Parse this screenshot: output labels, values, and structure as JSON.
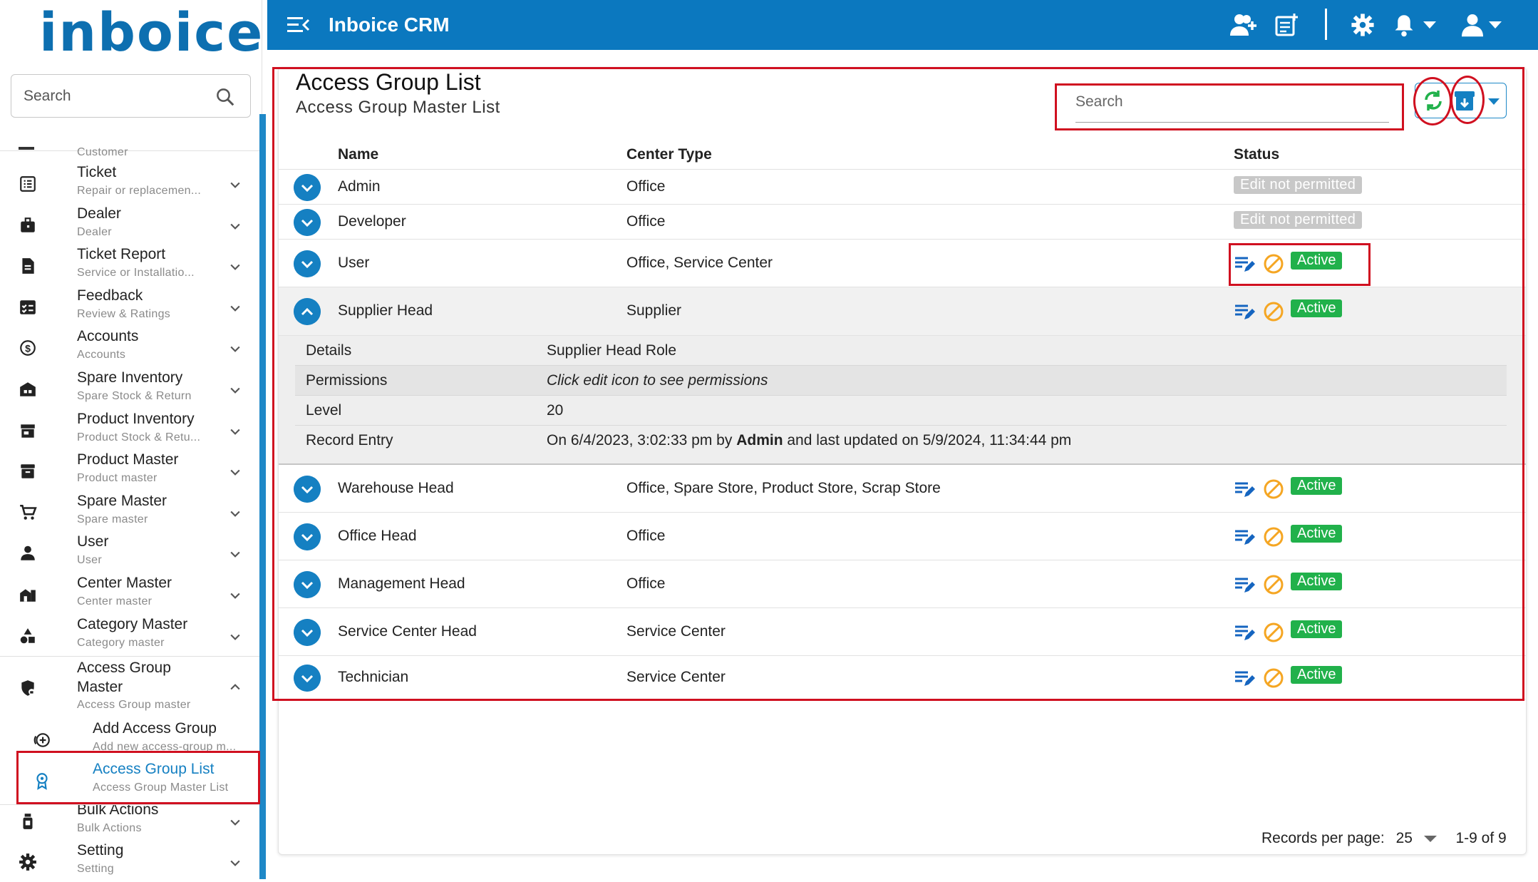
{
  "sidebar": {
    "logo_text": "inboice",
    "search_placeholder": "Search",
    "partial_item_sub": "Customer",
    "items": [
      {
        "label": "Ticket",
        "sub": "Repair or replacemen...",
        "icon": "list-icon"
      },
      {
        "label": "Dealer",
        "sub": "Dealer",
        "icon": "briefcase-icon"
      },
      {
        "label": "Ticket Report",
        "sub": "Service or Installatio...",
        "icon": "report-icon"
      },
      {
        "label": "Feedback",
        "sub": "Review & Ratings",
        "icon": "checklist-icon"
      },
      {
        "label": "Accounts",
        "sub": "Accounts",
        "icon": "currency-exchange-icon"
      },
      {
        "label": "Spare Inventory",
        "sub": "Spare Stock & Return",
        "icon": "warehouse-icon"
      },
      {
        "label": "Product Inventory",
        "sub": "Product Stock & Retu...",
        "icon": "store-icon"
      },
      {
        "label": "Product Master",
        "sub": "Product master",
        "icon": "archive-icon"
      },
      {
        "label": "Spare Master",
        "sub": "Spare master",
        "icon": "cart-icon"
      },
      {
        "label": "User",
        "sub": "User",
        "icon": "person-icon"
      },
      {
        "label": "Center Master",
        "sub": "Center master",
        "icon": "building-icon"
      },
      {
        "label": "Category Master",
        "sub": "Category master",
        "icon": "shapes-icon"
      }
    ],
    "access_group": {
      "label_line1": "Access Group",
      "label_line2": "Master",
      "sub": "Access Group master"
    },
    "sub_items": [
      {
        "label": "Add Access Group",
        "sub": "Add new access-group m..."
      },
      {
        "label": "Access Group List",
        "sub": "Access Group Master List"
      }
    ],
    "bottom_items": [
      {
        "label": "Bulk Actions",
        "sub": "Bulk Actions"
      },
      {
        "label": "Setting",
        "sub": "Setting"
      }
    ]
  },
  "topbar": {
    "title": "Inboice CRM"
  },
  "page": {
    "title": "Access Group List",
    "subtitle": "Access Group Master List",
    "search_placeholder": "Search"
  },
  "table": {
    "headers": {
      "name": "Name",
      "center_type": "Center Type",
      "status": "Status"
    },
    "rows": [
      {
        "name": "Admin",
        "center_type": "Office",
        "status": "Edit not permitted"
      },
      {
        "name": "Developer",
        "center_type": "Office",
        "status": "Edit not permitted"
      },
      {
        "name": "User",
        "center_type": "Office, Service Center",
        "status": "Active"
      },
      {
        "name": "Supplier Head",
        "center_type": "Supplier",
        "status": "Active"
      },
      {
        "name": "Warehouse Head",
        "center_type": "Office, Spare Store, Product Store, Scrap Store",
        "status": "Active"
      },
      {
        "name": "Office Head",
        "center_type": "Office",
        "status": "Active"
      },
      {
        "name": "Management Head",
        "center_type": "Office",
        "status": "Active"
      },
      {
        "name": "Service Center Head",
        "center_type": "Service Center",
        "status": "Active"
      },
      {
        "name": "Technician",
        "center_type": "Service Center",
        "status": "Active"
      }
    ],
    "details": {
      "details_label": "Details",
      "details_value": "Supplier Head Role",
      "permissions_label": "Permissions",
      "permissions_value": "Click edit icon to see permissions",
      "level_label": "Level",
      "level_value": "20",
      "record_label": "Record Entry",
      "record_prefix": "On 6/4/2023, 3:02:33 pm by",
      "record_user": "Admin",
      "record_suffix": "and last updated on 5/9/2024, 11:34:44 pm"
    }
  },
  "footer": {
    "records_label": "Records per page:",
    "per_page": "25",
    "range": "1-9 of 9"
  },
  "colors": {
    "topbar": "#0b78bf",
    "active": "#21b14b",
    "annotation": "#d01020",
    "accent": "#1580c2"
  }
}
